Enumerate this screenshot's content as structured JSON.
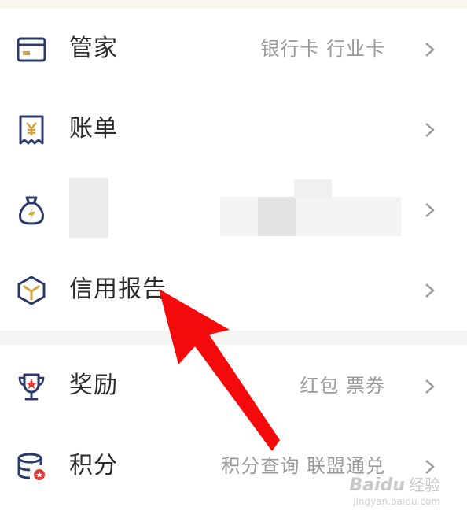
{
  "menu": {
    "steward": {
      "title": "管家",
      "subtitle": "银行卡 行业卡"
    },
    "bill": {
      "title": "账单"
    },
    "wealth": {
      "title": "",
      "subtitle": ""
    },
    "credit_report": {
      "title": "信用报告"
    },
    "rewards": {
      "title": "奖励",
      "subtitle": "红包 票券"
    },
    "points": {
      "title": "积分",
      "subtitle": "积分查询 联盟通兑"
    }
  },
  "watermark": {
    "brand": "Baidu",
    "brand2": "经验",
    "url": "jingyan.baidu.com"
  },
  "colors": {
    "icon_navy": "#2c3a6b",
    "icon_gold": "#d6a23a",
    "icon_red": "#e23b3b",
    "arrow": "#f40a0a",
    "chevron": "#9a9a9a"
  },
  "icons": [
    "card-icon",
    "receipt-icon",
    "money-bag-icon",
    "cube-icon",
    "trophy-icon",
    "coins-icon",
    "chevron-right-icon"
  ]
}
